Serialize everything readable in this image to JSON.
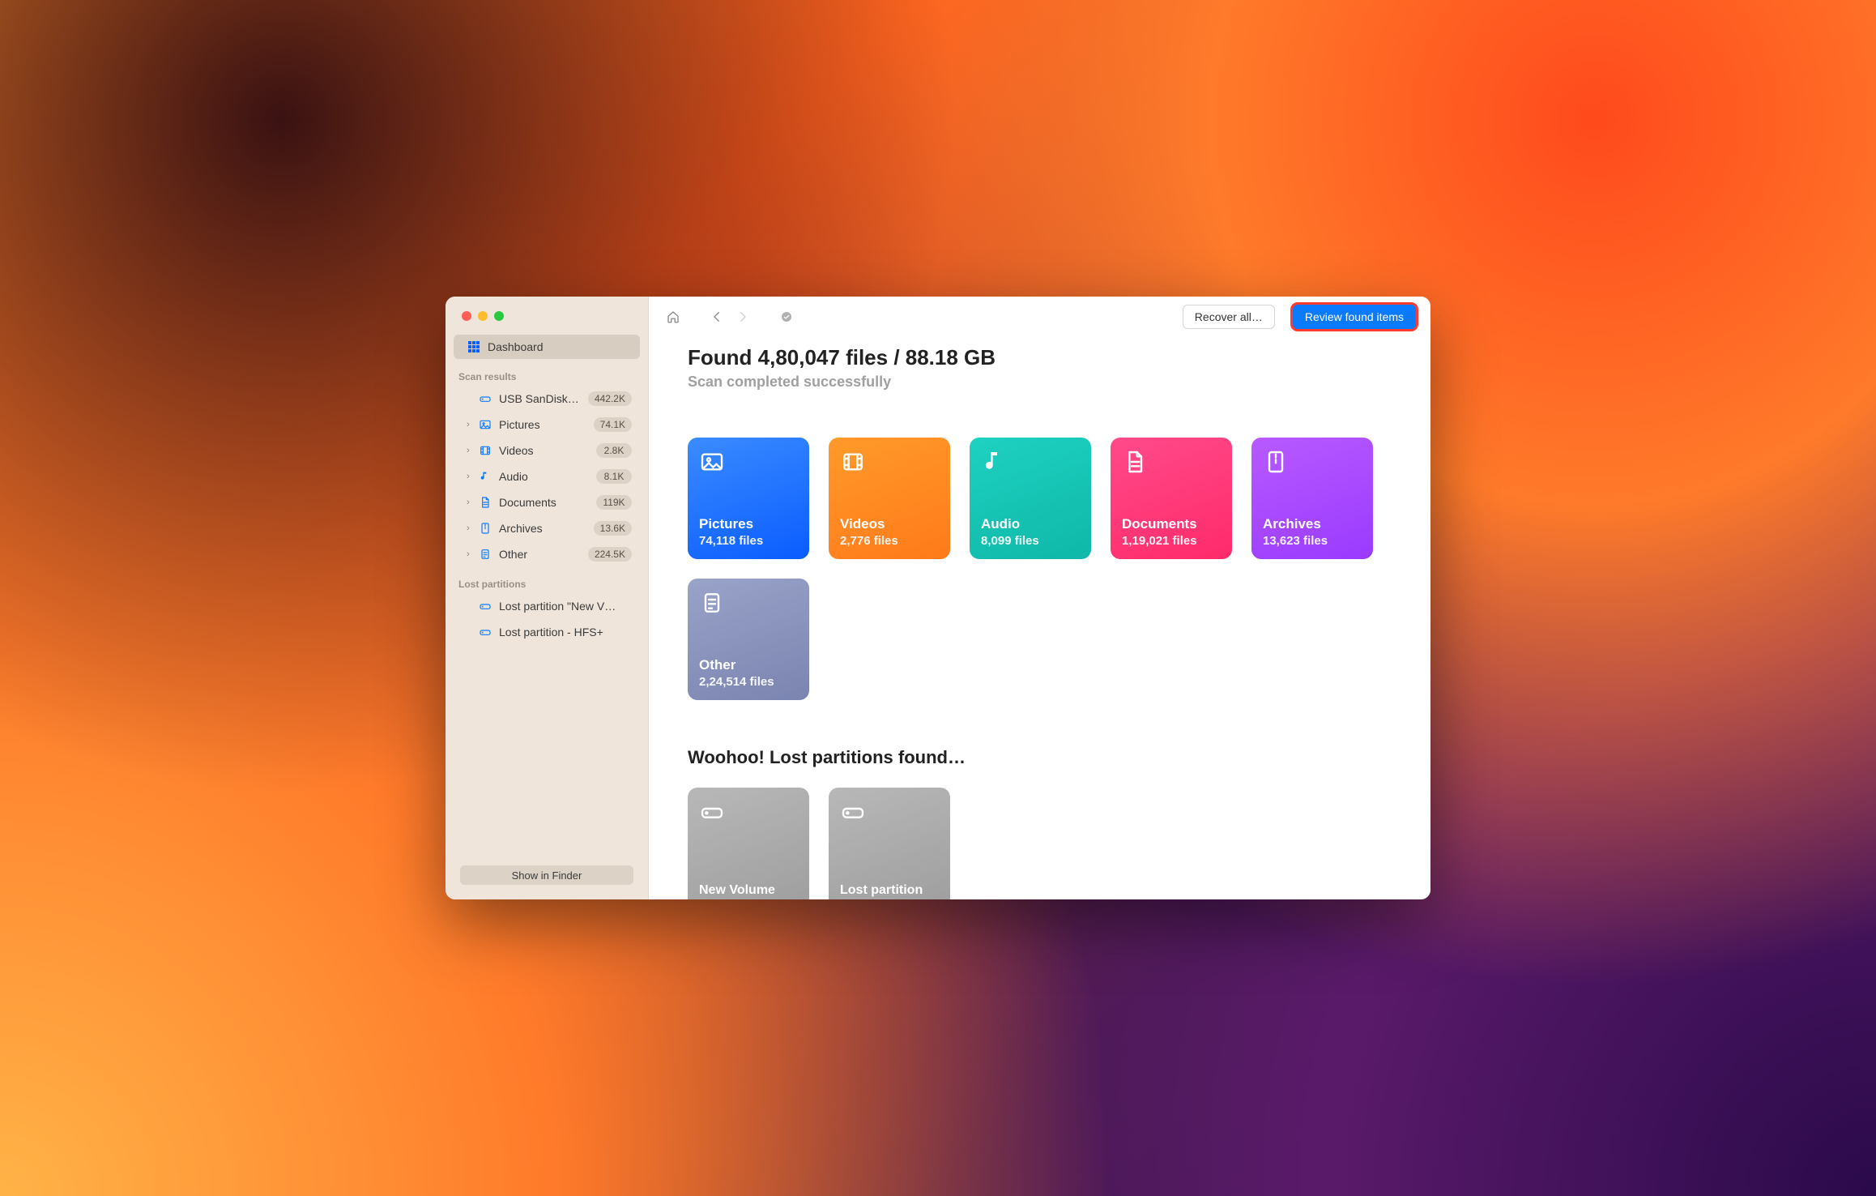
{
  "sidebar": {
    "dashboard": "Dashboard",
    "section_scan": "Scan results",
    "section_lost": "Lost partitions",
    "show_finder": "Show in Finder",
    "items": [
      {
        "label": "USB  SanDisk…",
        "count": "442.2K"
      },
      {
        "label": "Pictures",
        "count": "74.1K"
      },
      {
        "label": "Videos",
        "count": "2.8K"
      },
      {
        "label": "Audio",
        "count": "8.1K"
      },
      {
        "label": "Documents",
        "count": "119K"
      },
      {
        "label": "Archives",
        "count": "13.6K"
      },
      {
        "label": "Other",
        "count": "224.5K"
      }
    ],
    "lost": [
      {
        "label": "Lost partition \"New V…"
      },
      {
        "label": "Lost partition - HFS+"
      }
    ]
  },
  "toolbar": {
    "recover_all": "Recover all…",
    "review": "Review found items"
  },
  "summary": {
    "title": "Found 4,80,047 files / 88.18 GB",
    "subtitle": "Scan completed successfully"
  },
  "cards": [
    {
      "name": "Pictures",
      "count": "74,118 files"
    },
    {
      "name": "Videos",
      "count": "2,776 files"
    },
    {
      "name": "Audio",
      "count": "8,099 files"
    },
    {
      "name": "Documents",
      "count": "1,19,021 files"
    },
    {
      "name": "Archives",
      "count": "13,623 files"
    },
    {
      "name": "Other",
      "count": "2,24,514 files"
    }
  ],
  "partitions": {
    "heading": "Woohoo! Lost partitions found…",
    "items": [
      {
        "name": "New Volume"
      },
      {
        "name": "Lost partition"
      }
    ]
  }
}
